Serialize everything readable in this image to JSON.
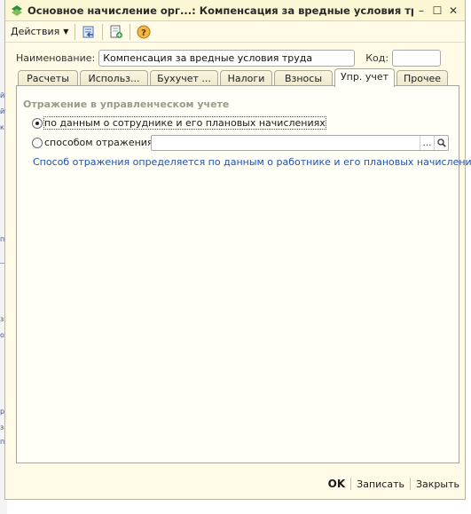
{
  "window": {
    "title": "Основное начисление орг...: Компенсация за вредные условия труда *",
    "buttons": {
      "minimize": "–",
      "maximize": "☐",
      "close": "✕"
    }
  },
  "toolbar": {
    "actions_label": "Действия",
    "icons": [
      "back-arrow-icon",
      "new-document-icon",
      "help-icon"
    ]
  },
  "fields": {
    "name_label": "Наименование:",
    "name_value": "Компенсация за вредные условия труда",
    "code_label": "Код:",
    "code_value": ""
  },
  "tabs": [
    {
      "label": "Расчеты"
    },
    {
      "label": "Использ..."
    },
    {
      "label": "Бухучет ..."
    },
    {
      "label": "Налоги"
    },
    {
      "label": "Взносы"
    },
    {
      "label": "Упр. учет",
      "active": true
    },
    {
      "label": "Прочее"
    }
  ],
  "panel": {
    "group_title": "Отражение в управленческом учете",
    "option1_label": "по данным о сотруднике и его плановых начислениях",
    "option2_label": "способом отражения:",
    "select_value": "",
    "info_text": "Способ отражения определяется по данным о работнике и его плановых начислениях"
  },
  "footer": {
    "ok_label": "OK",
    "save_label": "Записать",
    "close_label": "Закрыть"
  },
  "colors": {
    "window_bg": "#fffbe6",
    "info_text": "#1f52a8",
    "group_title": "#9a9a8a"
  }
}
